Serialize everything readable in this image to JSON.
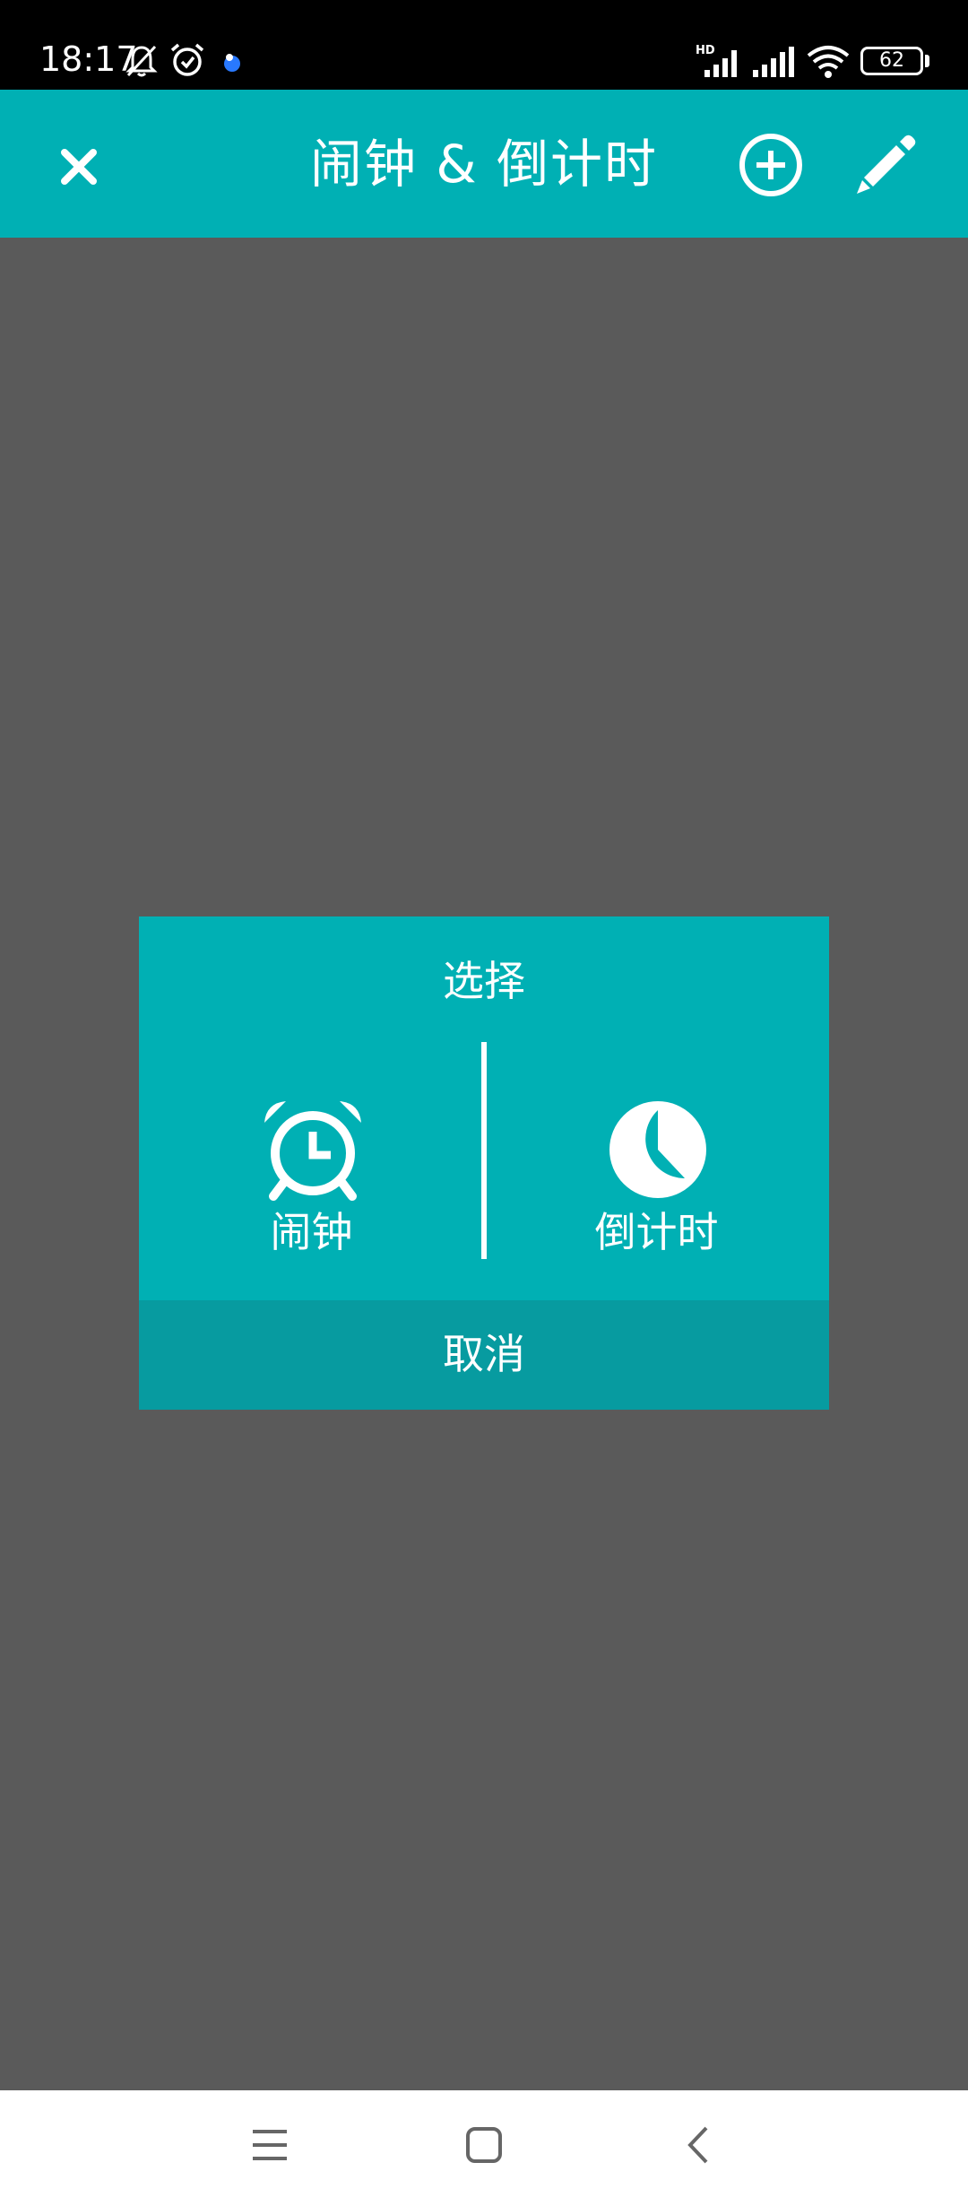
{
  "status_bar": {
    "time": "18:17",
    "battery": "62",
    "icons": [
      "bell-off-icon",
      "alarm-clock-icon",
      "app-notification-icon",
      "hd-signal-icon",
      "signal-icon",
      "wifi-icon",
      "battery-icon"
    ]
  },
  "app_bar": {
    "title": "闹钟 & 倒计时",
    "close_icon": "close-icon",
    "add_icon": "add-circle-icon",
    "edit_icon": "pencil-icon",
    "color": "#00b0b4"
  },
  "dialog": {
    "title": "选择",
    "options": [
      {
        "label": "闹钟",
        "icon": "alarm-clock-icon"
      },
      {
        "label": "倒计时",
        "icon": "pie-timer-icon"
      }
    ],
    "cancel_label": "取消",
    "color": "#00b0b4",
    "cancel_color": "#079ba0"
  },
  "nav_bar": {
    "icons": [
      "menu-icon",
      "home-icon",
      "back-icon"
    ]
  },
  "colors": {
    "scrim": "#5a5a5a",
    "accent": "#00b0b4"
  }
}
